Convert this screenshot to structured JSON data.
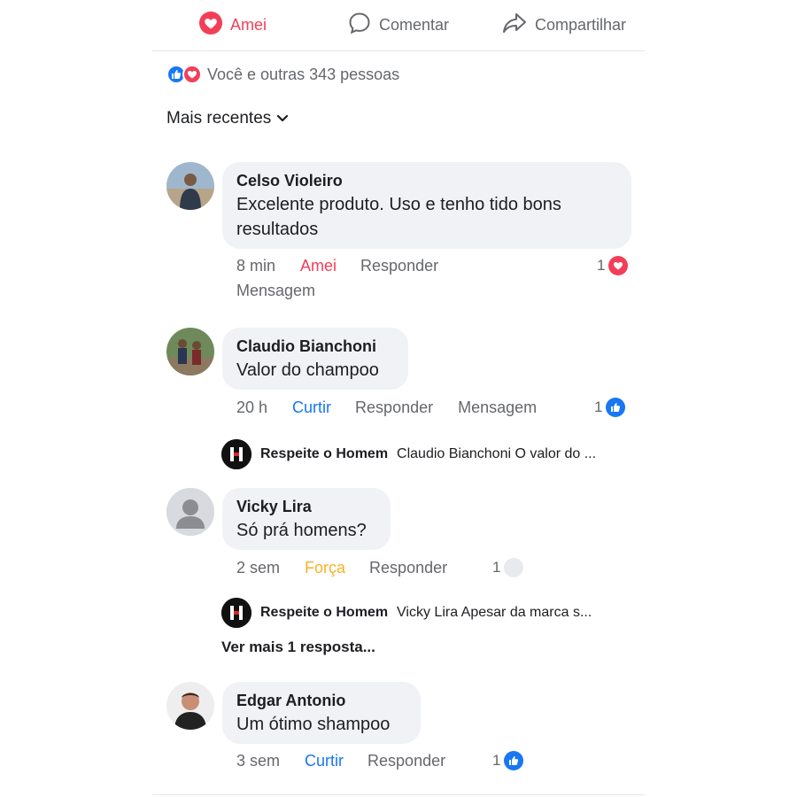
{
  "actions": {
    "amei": "Amei",
    "comentar": "Comentar",
    "compartilhar": "Compartilhar"
  },
  "summary": {
    "text": "Você e outras 343 pessoas"
  },
  "sort": {
    "label": "Mais recentes"
  },
  "colors": {
    "love": "#f33e58",
    "like": "#1877f2",
    "force": "#f7b125",
    "muted": "#65676b",
    "bubble": "#f0f2f5"
  },
  "comments": [
    {
      "name": "Celso Violeiro",
      "text_line1": "Excelente produto. Uso e tenho tido bons",
      "text_line2": "resultados",
      "time": "8 min",
      "reaction_label": "Amei",
      "reply_label": "Responder",
      "message_label": "Mensagem",
      "reaction_count": "1",
      "reaction_icon": "love-icon"
    },
    {
      "name": "Claudio Bianchoni",
      "text": "Valor do champoo",
      "time": "20 h",
      "reaction_label": "Curtir",
      "reply_label": "Responder",
      "message_label": "Mensagem",
      "reaction_count": "1",
      "reaction_icon": "like-icon",
      "reply": {
        "name": "Respeite o Homem",
        "text": "Claudio Bianchoni O valor do ..."
      }
    },
    {
      "name": "Vicky Lira",
      "text": "Só prá homens?",
      "time": "2 sem",
      "reaction_label": "Força",
      "reply_label": "Responder",
      "reaction_count": "1",
      "reaction_icon": "neutral-reaction-icon",
      "reply": {
        "name": "Respeite o Homem",
        "text": "Vicky Lira Apesar da marca s..."
      },
      "more_replies": "Ver mais 1 resposta..."
    },
    {
      "name": "Edgar Antonio",
      "text": "Um ótimo shampoo",
      "time": "3 sem",
      "reaction_label": "Curtir",
      "reply_label": "Responder",
      "reaction_count": "1",
      "reaction_icon": "like-icon"
    }
  ]
}
